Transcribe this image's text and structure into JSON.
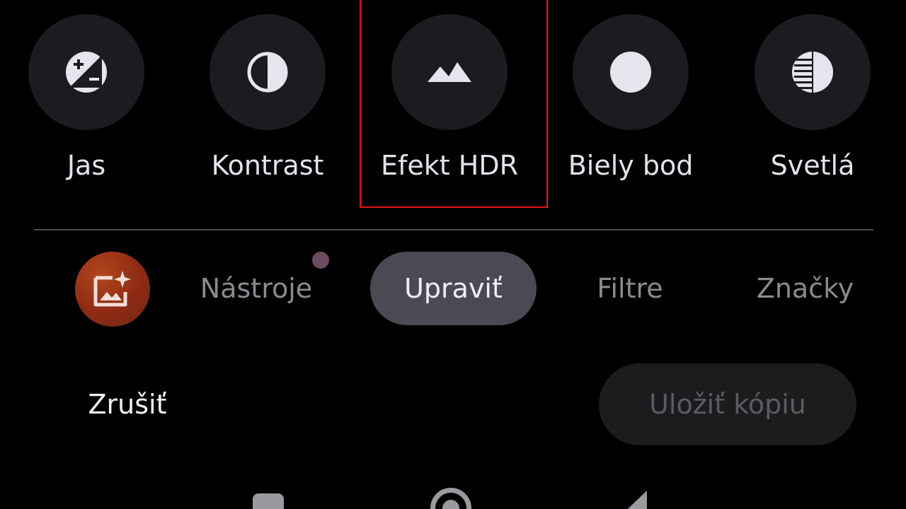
{
  "adjust_tools": [
    {
      "label": "Jas",
      "icon": "brightness-icon"
    },
    {
      "label": "Kontrast",
      "icon": "contrast-icon"
    },
    {
      "label": "Efekt HDR",
      "icon": "hdr-mountain-icon"
    },
    {
      "label": "Biely bod",
      "icon": "white-point-icon"
    },
    {
      "label": "Svetlá",
      "icon": "highlights-icon"
    }
  ],
  "highlight_color": "#e0161c",
  "tabs": {
    "assistant_icon": "photo-sparkle-icon",
    "tools": "Nástroje",
    "edit": "Upraviť",
    "filters": "Filtre",
    "markup": "Značky"
  },
  "actions": {
    "cancel": "Zrušiť",
    "save_copy": "Uložiť kópiu"
  },
  "colors": {
    "background": "#000000",
    "tool_circle": "#1b1b20",
    "active_tab": "#4b4a54",
    "assistant_button": "#8e2a14",
    "notification_dot": "#6e4a60"
  }
}
